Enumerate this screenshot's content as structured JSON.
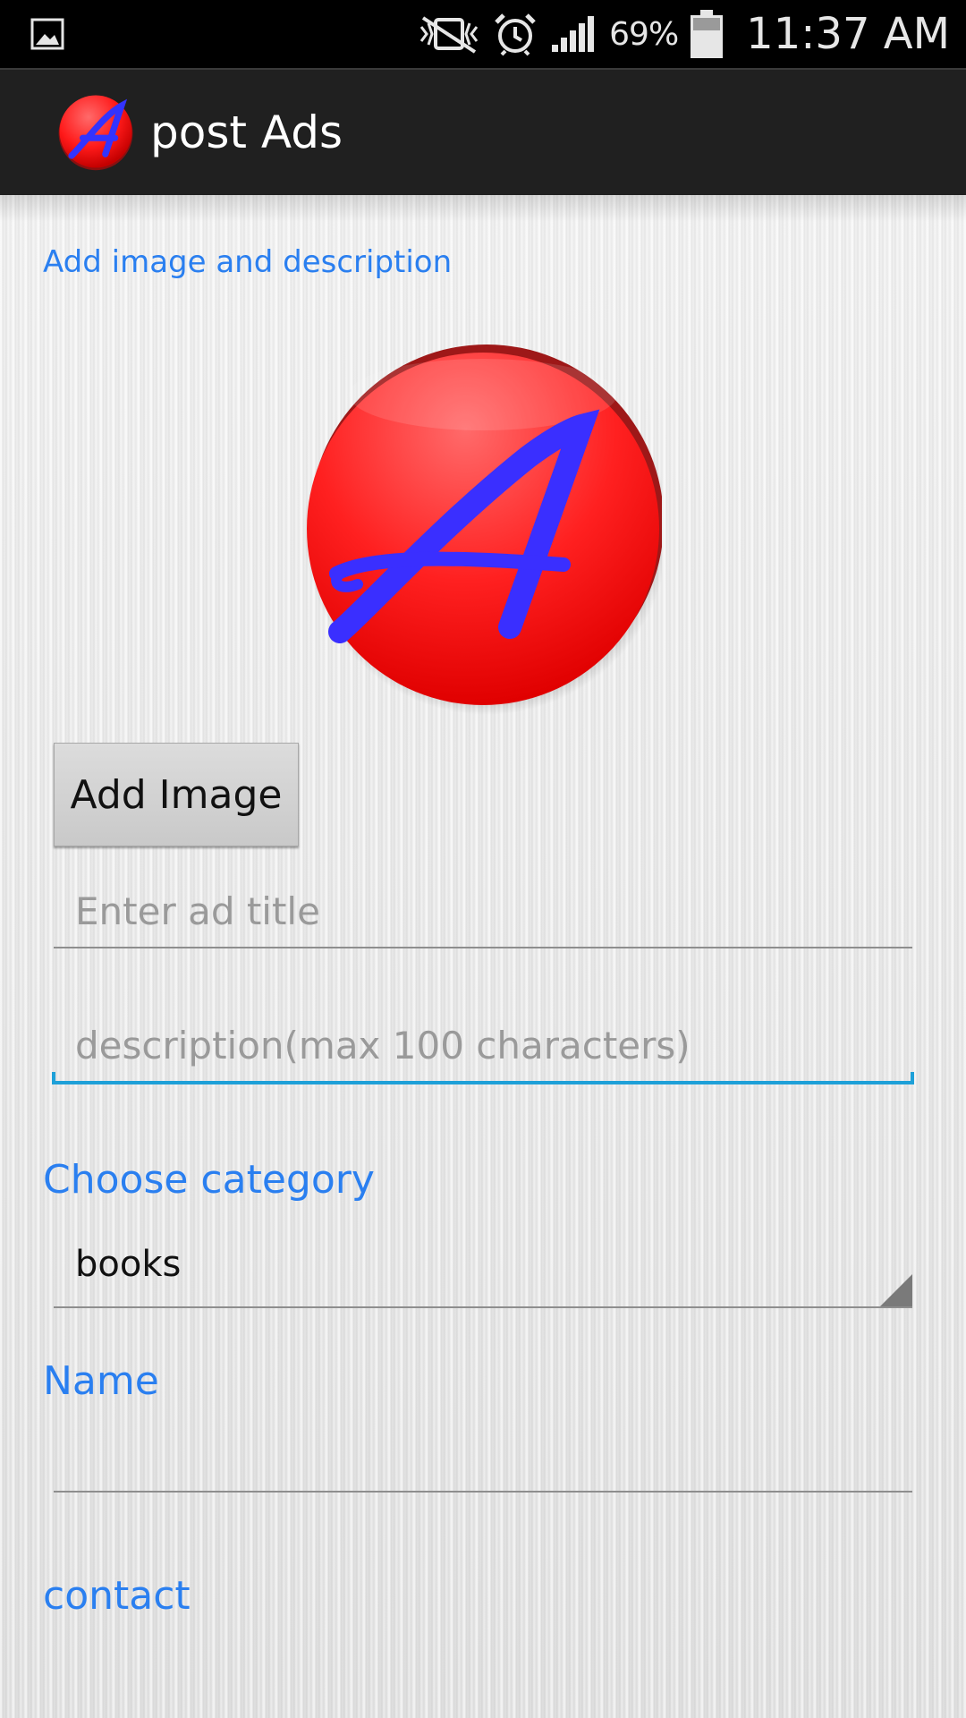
{
  "status_bar": {
    "battery_percent": "69%",
    "time": "11:37 AM"
  },
  "action_bar": {
    "title": "post Ads",
    "logo_icon": "app-logo-icon"
  },
  "form": {
    "section_label": "Add image and description",
    "ad_image_letter": "A",
    "add_image_button": "Add Image",
    "title_placeholder": "Enter ad title",
    "description_placeholder": "description(max 100 characters)",
    "category_label": "Choose category",
    "category_selected": "books",
    "name_label": "Name",
    "contact_label": "contact"
  },
  "colors": {
    "accent_blue": "#2a7ff0",
    "focus_line": "#1ea0d8",
    "logo_red": "#ff1a1a",
    "logo_letter_blue": "#3333ff"
  }
}
